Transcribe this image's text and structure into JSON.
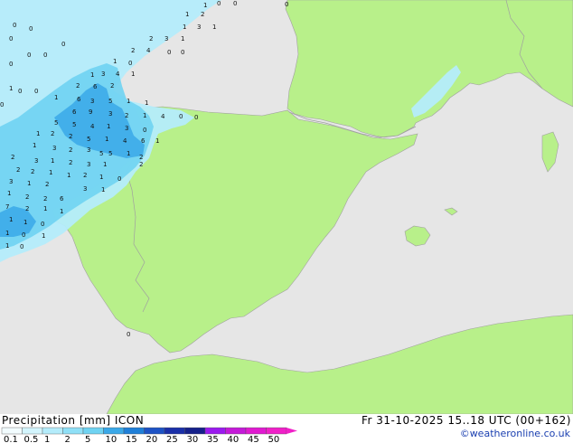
{
  "map": {
    "colors": {
      "sea": "#e6e6e6",
      "land": "#b8f08a",
      "border": "#a0a0a0",
      "precip_light": "#b4ecfb",
      "precip_mid": "#6fd3f2",
      "precip_heavy": "#3aa8e8"
    },
    "point_values": [
      {
        "v": "1"
      },
      {
        "v": "2"
      },
      {
        "v": "0"
      },
      {
        "v": "1"
      },
      {
        "v": "0"
      },
      {
        "v": "0"
      },
      {
        "v": "0"
      },
      {
        "v": "1"
      },
      {
        "v": "3"
      },
      {
        "v": "1"
      },
      {
        "v": "0"
      },
      {
        "v": "2"
      },
      {
        "v": "3"
      },
      {
        "v": "1"
      },
      {
        "v": "0"
      },
      {
        "v": "0"
      },
      {
        "v": "2"
      },
      {
        "v": "4"
      },
      {
        "v": "0"
      },
      {
        "v": "0"
      },
      {
        "v": "0"
      },
      {
        "v": "0"
      },
      {
        "v": "1"
      },
      {
        "v": "0"
      },
      {
        "v": "1"
      },
      {
        "v": "3"
      },
      {
        "v": "4"
      },
      {
        "v": "1"
      },
      {
        "v": "0"
      },
      {
        "v": "2"
      },
      {
        "v": "6"
      },
      {
        "v": "2"
      },
      {
        "v": "1"
      },
      {
        "v": "0"
      },
      {
        "v": "0"
      },
      {
        "v": "0"
      },
      {
        "v": "1"
      },
      {
        "v": "6"
      },
      {
        "v": "3"
      },
      {
        "v": "5"
      },
      {
        "v": "1"
      },
      {
        "v": "1"
      },
      {
        "v": "6"
      },
      {
        "v": "9"
      },
      {
        "v": "3"
      },
      {
        "v": "2"
      },
      {
        "v": "1"
      },
      {
        "v": "4"
      },
      {
        "v": "0"
      },
      {
        "v": "0"
      },
      {
        "v": "5"
      },
      {
        "v": "5"
      },
      {
        "v": "4"
      },
      {
        "v": "1"
      },
      {
        "v": "3"
      },
      {
        "v": "0"
      },
      {
        "v": "1"
      },
      {
        "v": "2"
      },
      {
        "v": "2"
      },
      {
        "v": "5"
      },
      {
        "v": "1"
      },
      {
        "v": "4"
      },
      {
        "v": "6"
      },
      {
        "v": "1"
      },
      {
        "v": "1"
      },
      {
        "v": "3"
      },
      {
        "v": "2"
      },
      {
        "v": "3"
      },
      {
        "v": "5"
      },
      {
        "v": "5"
      },
      {
        "v": "1"
      },
      {
        "v": "2"
      },
      {
        "v": "3"
      },
      {
        "v": "1"
      },
      {
        "v": "2"
      },
      {
        "v": "3"
      },
      {
        "v": "1"
      },
      {
        "v": "2"
      },
      {
        "v": "2"
      },
      {
        "v": "2"
      },
      {
        "v": "1"
      },
      {
        "v": "1"
      },
      {
        "v": "2"
      },
      {
        "v": "2"
      },
      {
        "v": "1"
      },
      {
        "v": "0"
      },
      {
        "v": "3"
      },
      {
        "v": "1"
      },
      {
        "v": "2"
      },
      {
        "v": "3"
      },
      {
        "v": "1"
      },
      {
        "v": "1"
      },
      {
        "v": "2"
      },
      {
        "v": "2"
      },
      {
        "v": "6"
      },
      {
        "v": "7"
      },
      {
        "v": "2"
      },
      {
        "v": "1"
      },
      {
        "v": "1"
      },
      {
        "v": "1"
      },
      {
        "v": "1"
      },
      {
        "v": "0"
      },
      {
        "v": "1"
      },
      {
        "v": "0"
      },
      {
        "v": "1"
      },
      {
        "v": "0"
      },
      {
        "v": "1"
      },
      {
        "v": "0"
      }
    ]
  },
  "footer": {
    "title_left": "Precipitation [mm]  ICON",
    "title_right": "Fr 31-10-2025 15..18 UTC (00+162)",
    "credit": "©weatheronline.co.uk",
    "legend": {
      "ticks": [
        "0.1",
        "0.5",
        "1",
        "2",
        "5",
        "10",
        "15",
        "20",
        "25",
        "30",
        "35",
        "40",
        "45",
        "50"
      ],
      "colors": [
        "#f2fcfe",
        "#d3f5fd",
        "#b4ecfb",
        "#8fe0f7",
        "#6fd3f2",
        "#3aa8e8",
        "#1f7fd8",
        "#1d52c5",
        "#1a2fa8",
        "#15208a",
        "#9a1aee",
        "#c41ad8",
        "#e01ad0",
        "#f020c8"
      ]
    }
  }
}
